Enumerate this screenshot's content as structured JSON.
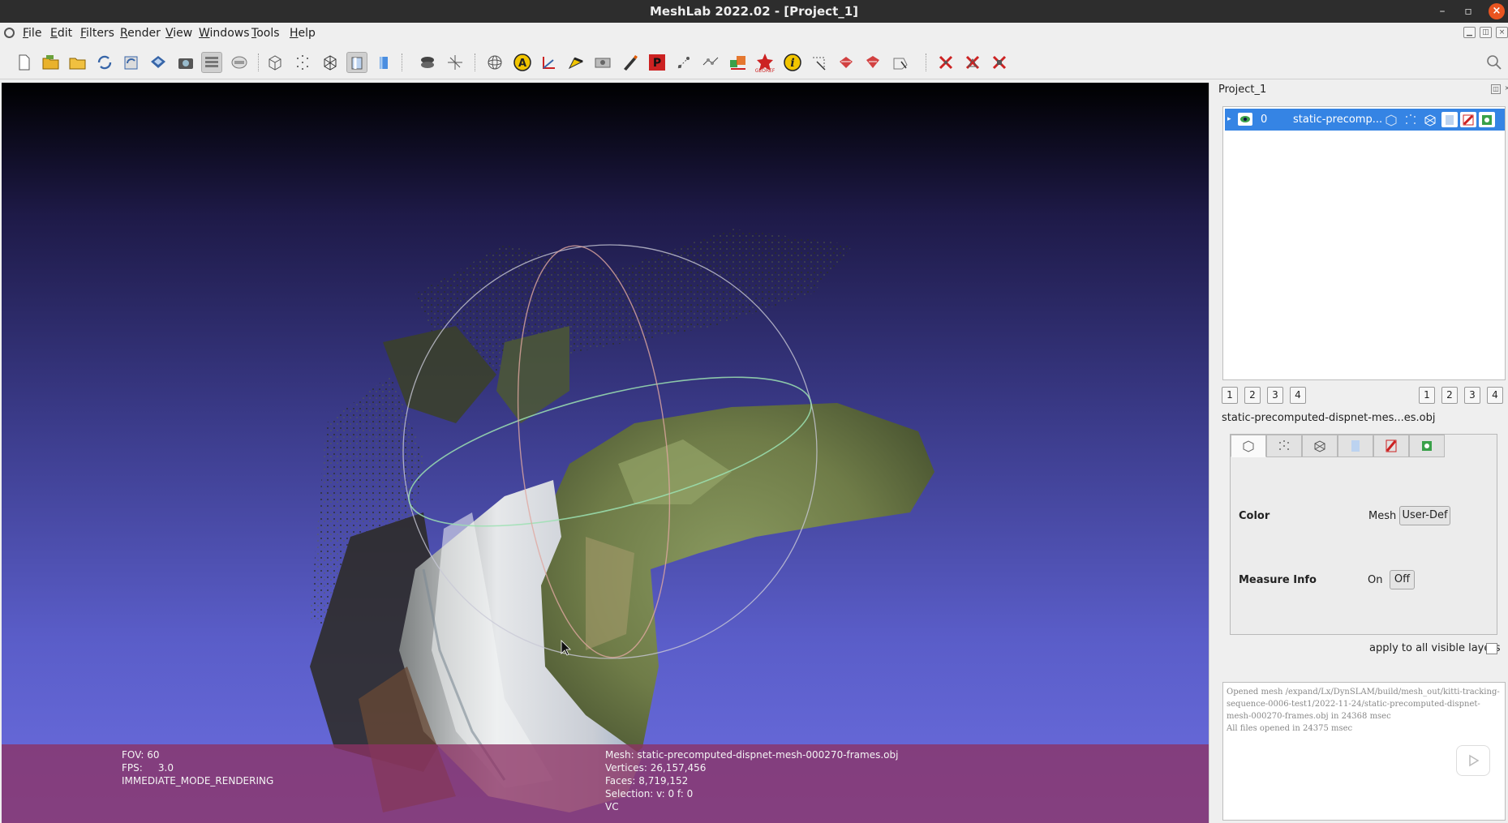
{
  "window": {
    "title": "MeshLab 2022.02 - [Project_1]",
    "minimize_glyph": "–",
    "maximize_glyph": "▫",
    "close_glyph": "×"
  },
  "menu": {
    "items": [
      {
        "label": "File",
        "mnemonic": "F",
        "rest": "ile"
      },
      {
        "label": "Edit",
        "mnemonic": "E",
        "rest": "dit"
      },
      {
        "label": "Filters",
        "mnemonic": "F",
        "rest": "ilters"
      },
      {
        "label": "Render",
        "mnemonic": "R",
        "rest": "ender"
      },
      {
        "label": "View",
        "mnemonic": "V",
        "rest": "iew"
      },
      {
        "label": "Windows",
        "mnemonic": "W",
        "rest": "indows"
      },
      {
        "label": "Tools",
        "mnemonic": "T",
        "rest": "ools"
      },
      {
        "label": "Help",
        "mnemonic": "H",
        "rest": "elp"
      }
    ]
  },
  "toolbar": {
    "icons": [
      "new-project-icon",
      "open-project-icon",
      "import-mesh-icon",
      "reload-icon",
      "reload-all-icon",
      "export-mesh-icon",
      "snapshot-icon",
      "layers-icon",
      "raster-icon",
      "bbox-icon",
      "points-icon",
      "wireframe-icon",
      "flat-lines-icon",
      "flat-icon",
      "light-icon",
      "axis-icon",
      "trackball-icon",
      "annotation-icon",
      "measure-icon",
      "select-faces-icon",
      "select-vertexes-icon",
      "paint-icon",
      "pick-points-icon",
      "align-icon",
      "manipulate-icon",
      "raster-align-icon",
      "georef-icon",
      "info-icon",
      "select-conn-icon",
      "mutual-corrs-icon",
      "delete-faces-icon",
      "select-area-icon",
      "delete-selected-faces-icon",
      "delete-selected-vertices-icon",
      "delete-selected-all-icon"
    ],
    "search_icon": "search-icon",
    "accent_red": "#cc2222",
    "accent_yellow": "#f2c500"
  },
  "viewport": {
    "hud_left": {
      "fov": "FOV: 60",
      "fps": "FPS:     3.0",
      "mode": "IMMEDIATE_MODE_RENDERING"
    },
    "hud_right": {
      "mesh": "Mesh: static-precomputed-dispnet-mesh-000270-frames.obj",
      "vertices": "Vertices: 26,157,456",
      "faces": "Faces: 8,719,152",
      "selection": "Selection: v: 0 f: 0",
      "vc": "VC"
    }
  },
  "side_panel": {
    "title": "Project_1",
    "layer": {
      "index": "0",
      "name": "static-precomp..."
    },
    "view_buttons_left": [
      "1",
      "2",
      "3",
      "4"
    ],
    "view_buttons_right": [
      "1",
      "2",
      "3",
      "4"
    ],
    "mesh_file": "static-precomputed-dispnet-mes...es.obj",
    "props": {
      "color_label": "Color",
      "color_mesh": "Mesh",
      "color_mode": "User-Def",
      "measure_label": "Measure Info",
      "measure_on": "On",
      "measure_off": "Off"
    },
    "apply_label": "apply to all visible layers",
    "log": [
      "Opened mesh /expand/Lx/DynSLAM/build/mesh_out/kitti-tracking-sequence-0006-test1/2022-11-24/static-precomputed-dispnet-mesh-000270-frames.obj in 24368 msec",
      "All files opened in 24375 msec"
    ]
  }
}
